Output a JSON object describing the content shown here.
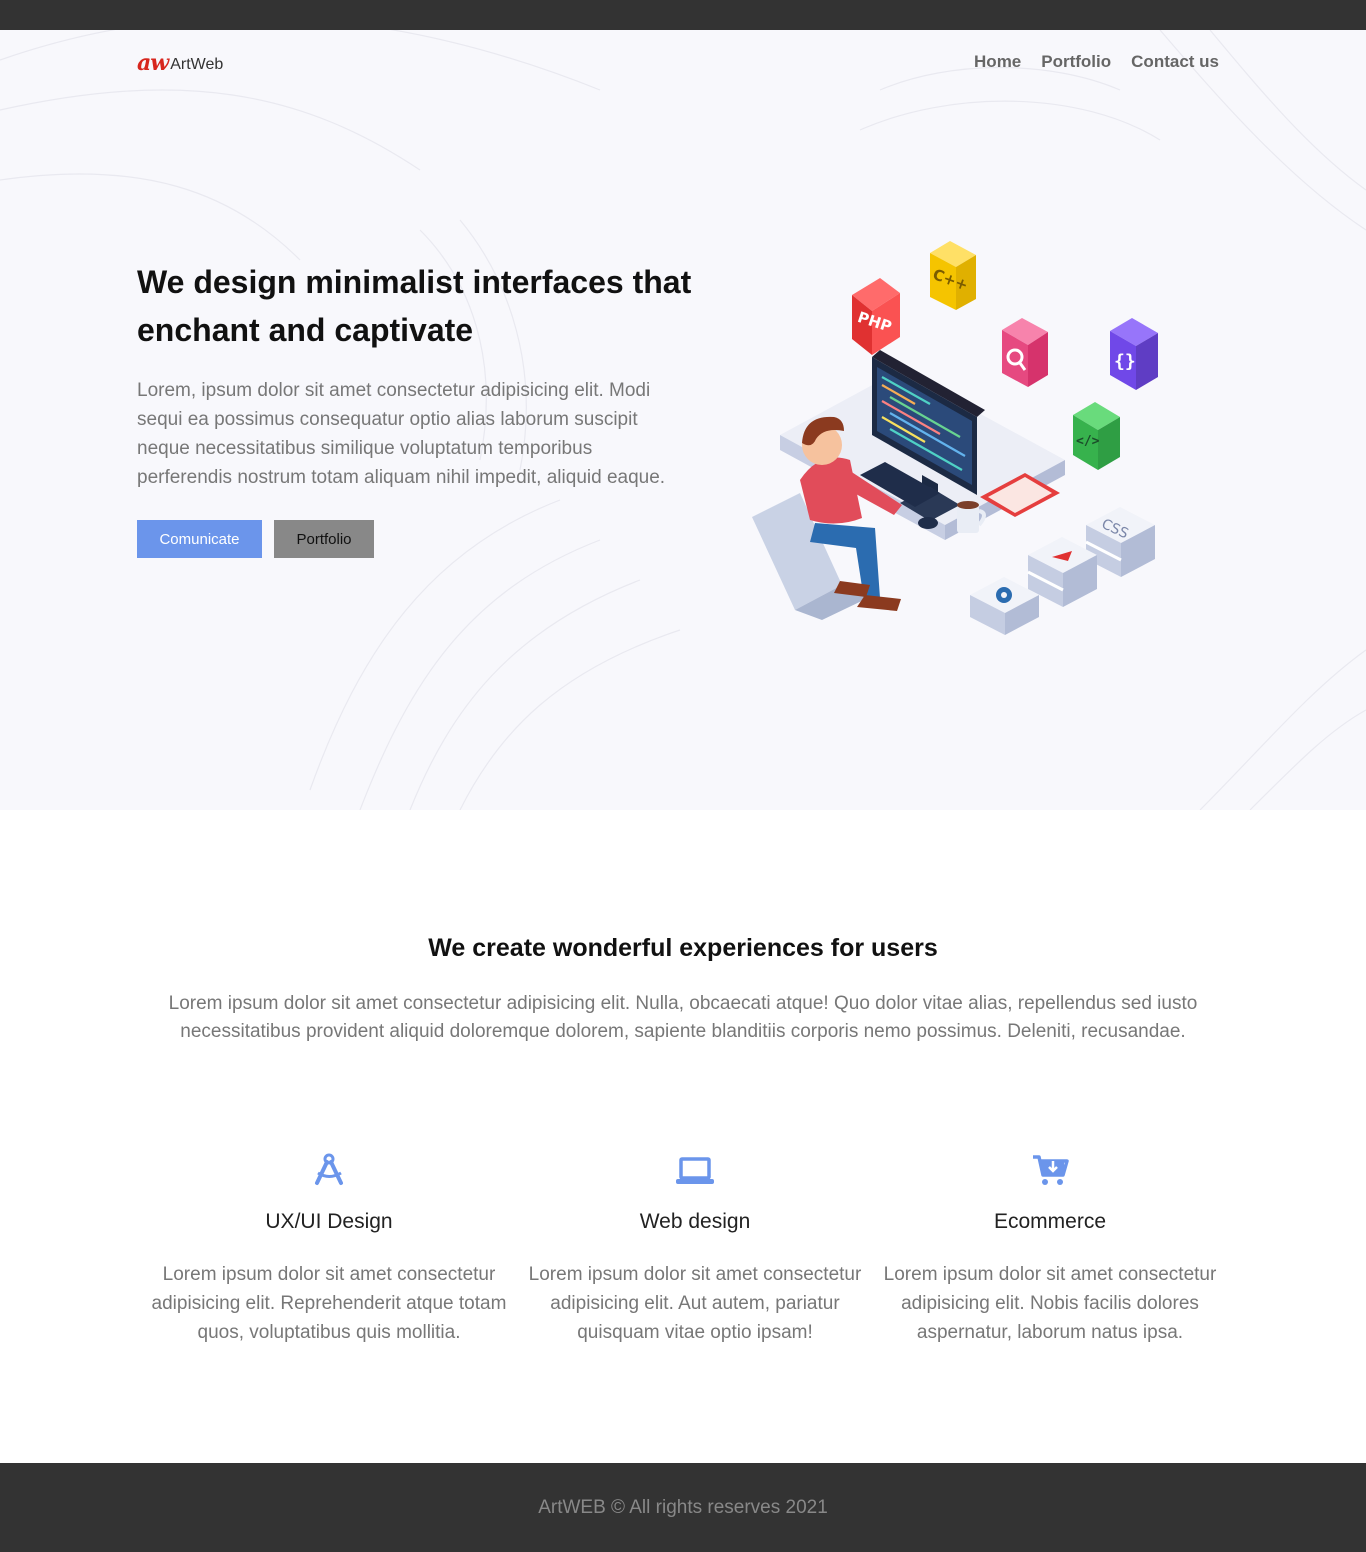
{
  "logo": {
    "mark": "aw",
    "text": "ArtWeb"
  },
  "nav": {
    "items": [
      "Home",
      "Portfolio",
      "Contact us"
    ]
  },
  "hero": {
    "title": "We design minimalist interfaces that enchant and captivate",
    "text": "Lorem, ipsum dolor sit amet consectetur adipisicing elit. Modi sequi ea possimus consequatur optio alias laborum suscipit neque necessitatibus similique voluptatum temporibus perferendis nostrum totam aliquam nihil impedit, aliquid eaque.",
    "primary_button": "Comunicate",
    "secondary_button": "Portfolio",
    "illustration": {
      "icons": [
        "PHP",
        "C++",
        "{}",
        "</>",
        "CSS"
      ]
    }
  },
  "section": {
    "title": "We create wonderful experiences for users",
    "text": "Lorem ipsum dolor sit amet consectetur adipisicing elit. Nulla, obcaecati atque! Quo dolor vitae alias, repellendus sed iusto necessitatibus provident aliquid doloremque dolorem, sapiente blanditiis corporis nemo possimus. Deleniti, recusandae."
  },
  "features": [
    {
      "icon": "drafting-compass-icon",
      "title": "UX/UI Design",
      "text": "Lorem ipsum dolor sit amet consectetur adipisicing elit. Reprehenderit atque totam quos, voluptatibus quis mollitia."
    },
    {
      "icon": "laptop-icon",
      "title": "Web design",
      "text": "Lorem ipsum dolor sit amet consectetur adipisicing elit. Aut autem, pariatur quisquam vitae optio ipsam!"
    },
    {
      "icon": "shopping-cart-icon",
      "title": "Ecommerce",
      "text": "Lorem ipsum dolor sit amet consectetur adipisicing elit. Nobis facilis dolores aspernatur, laborum natus ipsa."
    }
  ],
  "footer": {
    "text": "ArtWEB © All rights reserves 2021"
  },
  "colors": {
    "accent": "#6b95eb",
    "dark": "#333333",
    "hero_bg": "#f8f8fc",
    "muted_text": "#777777"
  }
}
